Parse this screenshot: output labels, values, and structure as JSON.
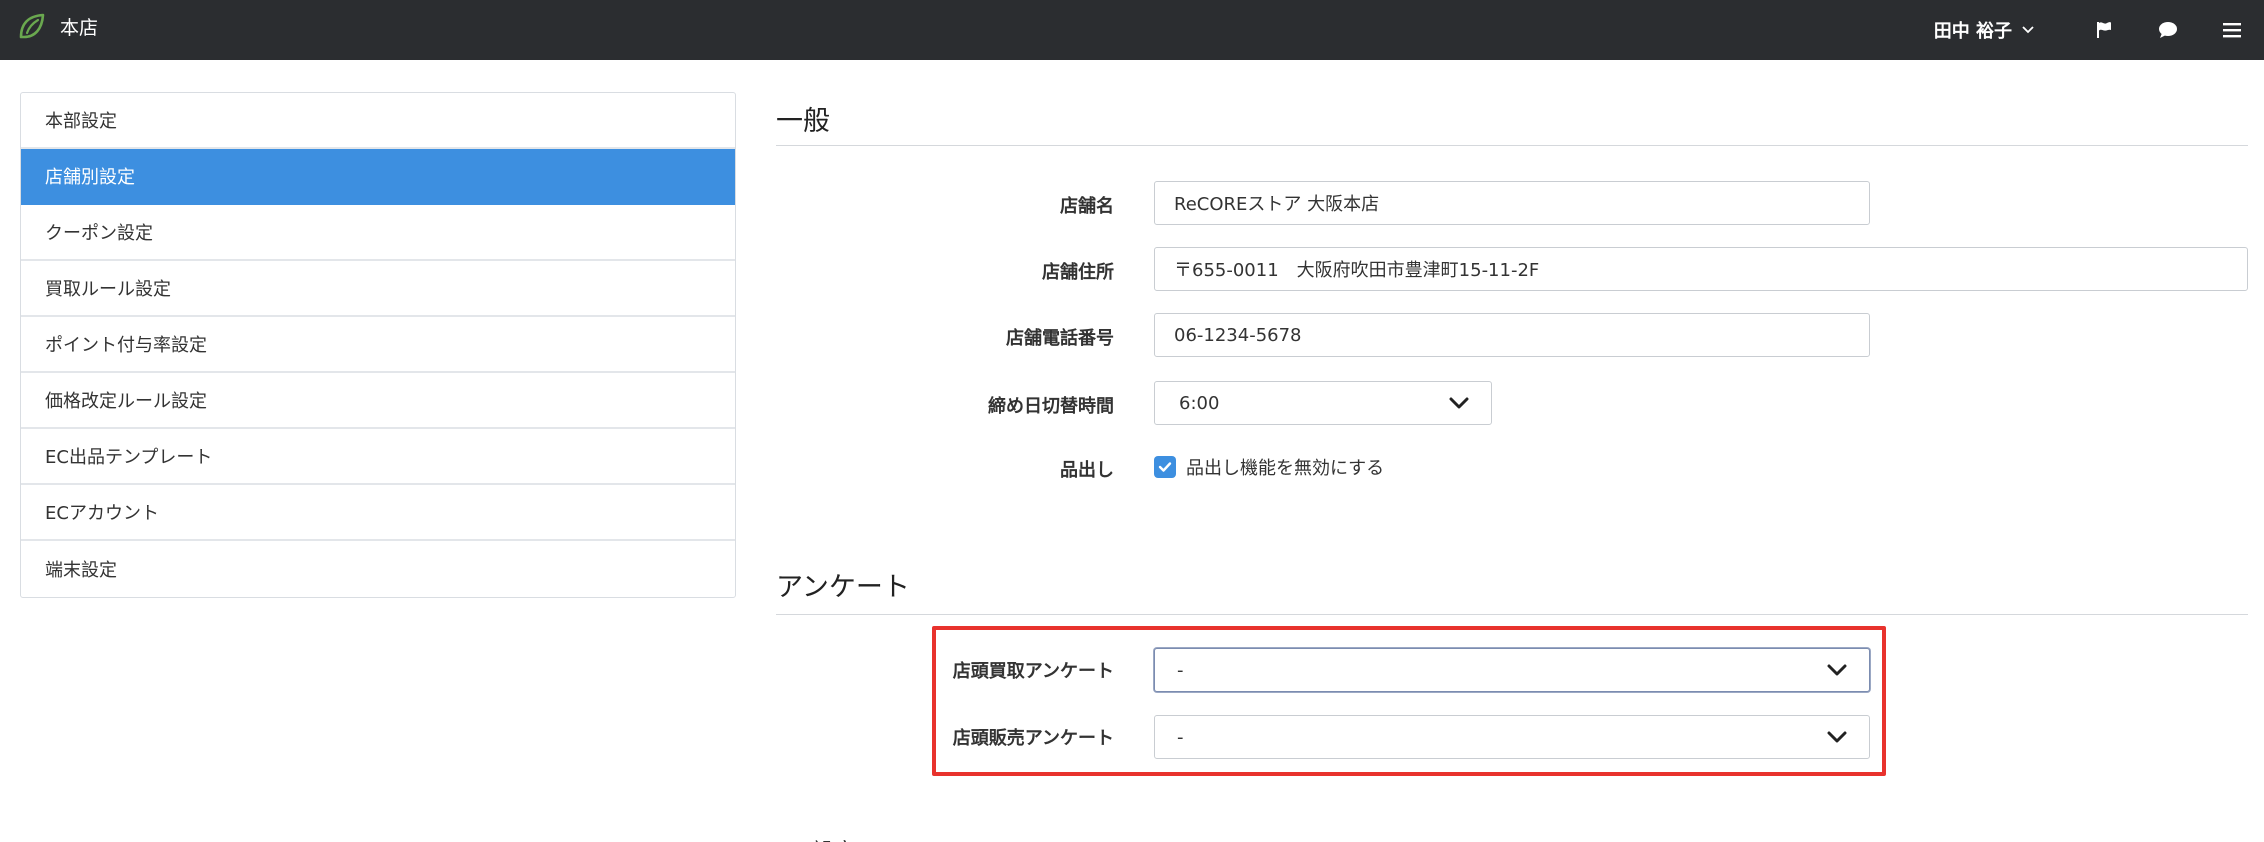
{
  "navbar": {
    "brand_name": "本店",
    "user_name": "田中 裕子",
    "icons": [
      "leaf-logo-icon",
      "chevron-down-icon",
      "flag-icon",
      "comment-icon",
      "hamburger-menu-icon"
    ]
  },
  "sidebar": {
    "items": [
      {
        "label": "本部設定",
        "active": false
      },
      {
        "label": "店舗別設定",
        "active": true
      },
      {
        "label": "クーポン設定",
        "active": false
      },
      {
        "label": "買取ルール設定",
        "active": false
      },
      {
        "label": "ポイント付与率設定",
        "active": false
      },
      {
        "label": "価格改定ルール設定",
        "active": false
      },
      {
        "label": "EC出品テンプレート",
        "active": false
      },
      {
        "label": "ECアカウント",
        "active": false
      },
      {
        "label": "端末設定",
        "active": false
      }
    ]
  },
  "general": {
    "title": "一般",
    "store_name": {
      "label": "店舗名",
      "value": "ReCOREストア 大阪本店"
    },
    "store_address": {
      "label": "店舗住所",
      "value": "〒655-0011　大阪府吹田市豊津町15-11-2F"
    },
    "store_phone": {
      "label": "店舗電話番号",
      "value": "06-1234-5678"
    },
    "cutoff_time": {
      "label": "締め日切替時間",
      "value": "6:00"
    },
    "display": {
      "label": "品出し",
      "checkbox_label": "品出し機能を無効にする",
      "checked": true
    }
  },
  "survey": {
    "title": "アンケート",
    "purchase_survey": {
      "label": "店頭買取アンケート",
      "value": "-"
    },
    "sales_survey": {
      "label": "店頭販売アンケート",
      "value": "-"
    }
  },
  "next_section_peek": "設定",
  "colors": {
    "navbar_bg": "#2b2d30",
    "accent": "#3d8fe0",
    "logo_green": "#6aa84f",
    "highlight": "#e8322d"
  }
}
